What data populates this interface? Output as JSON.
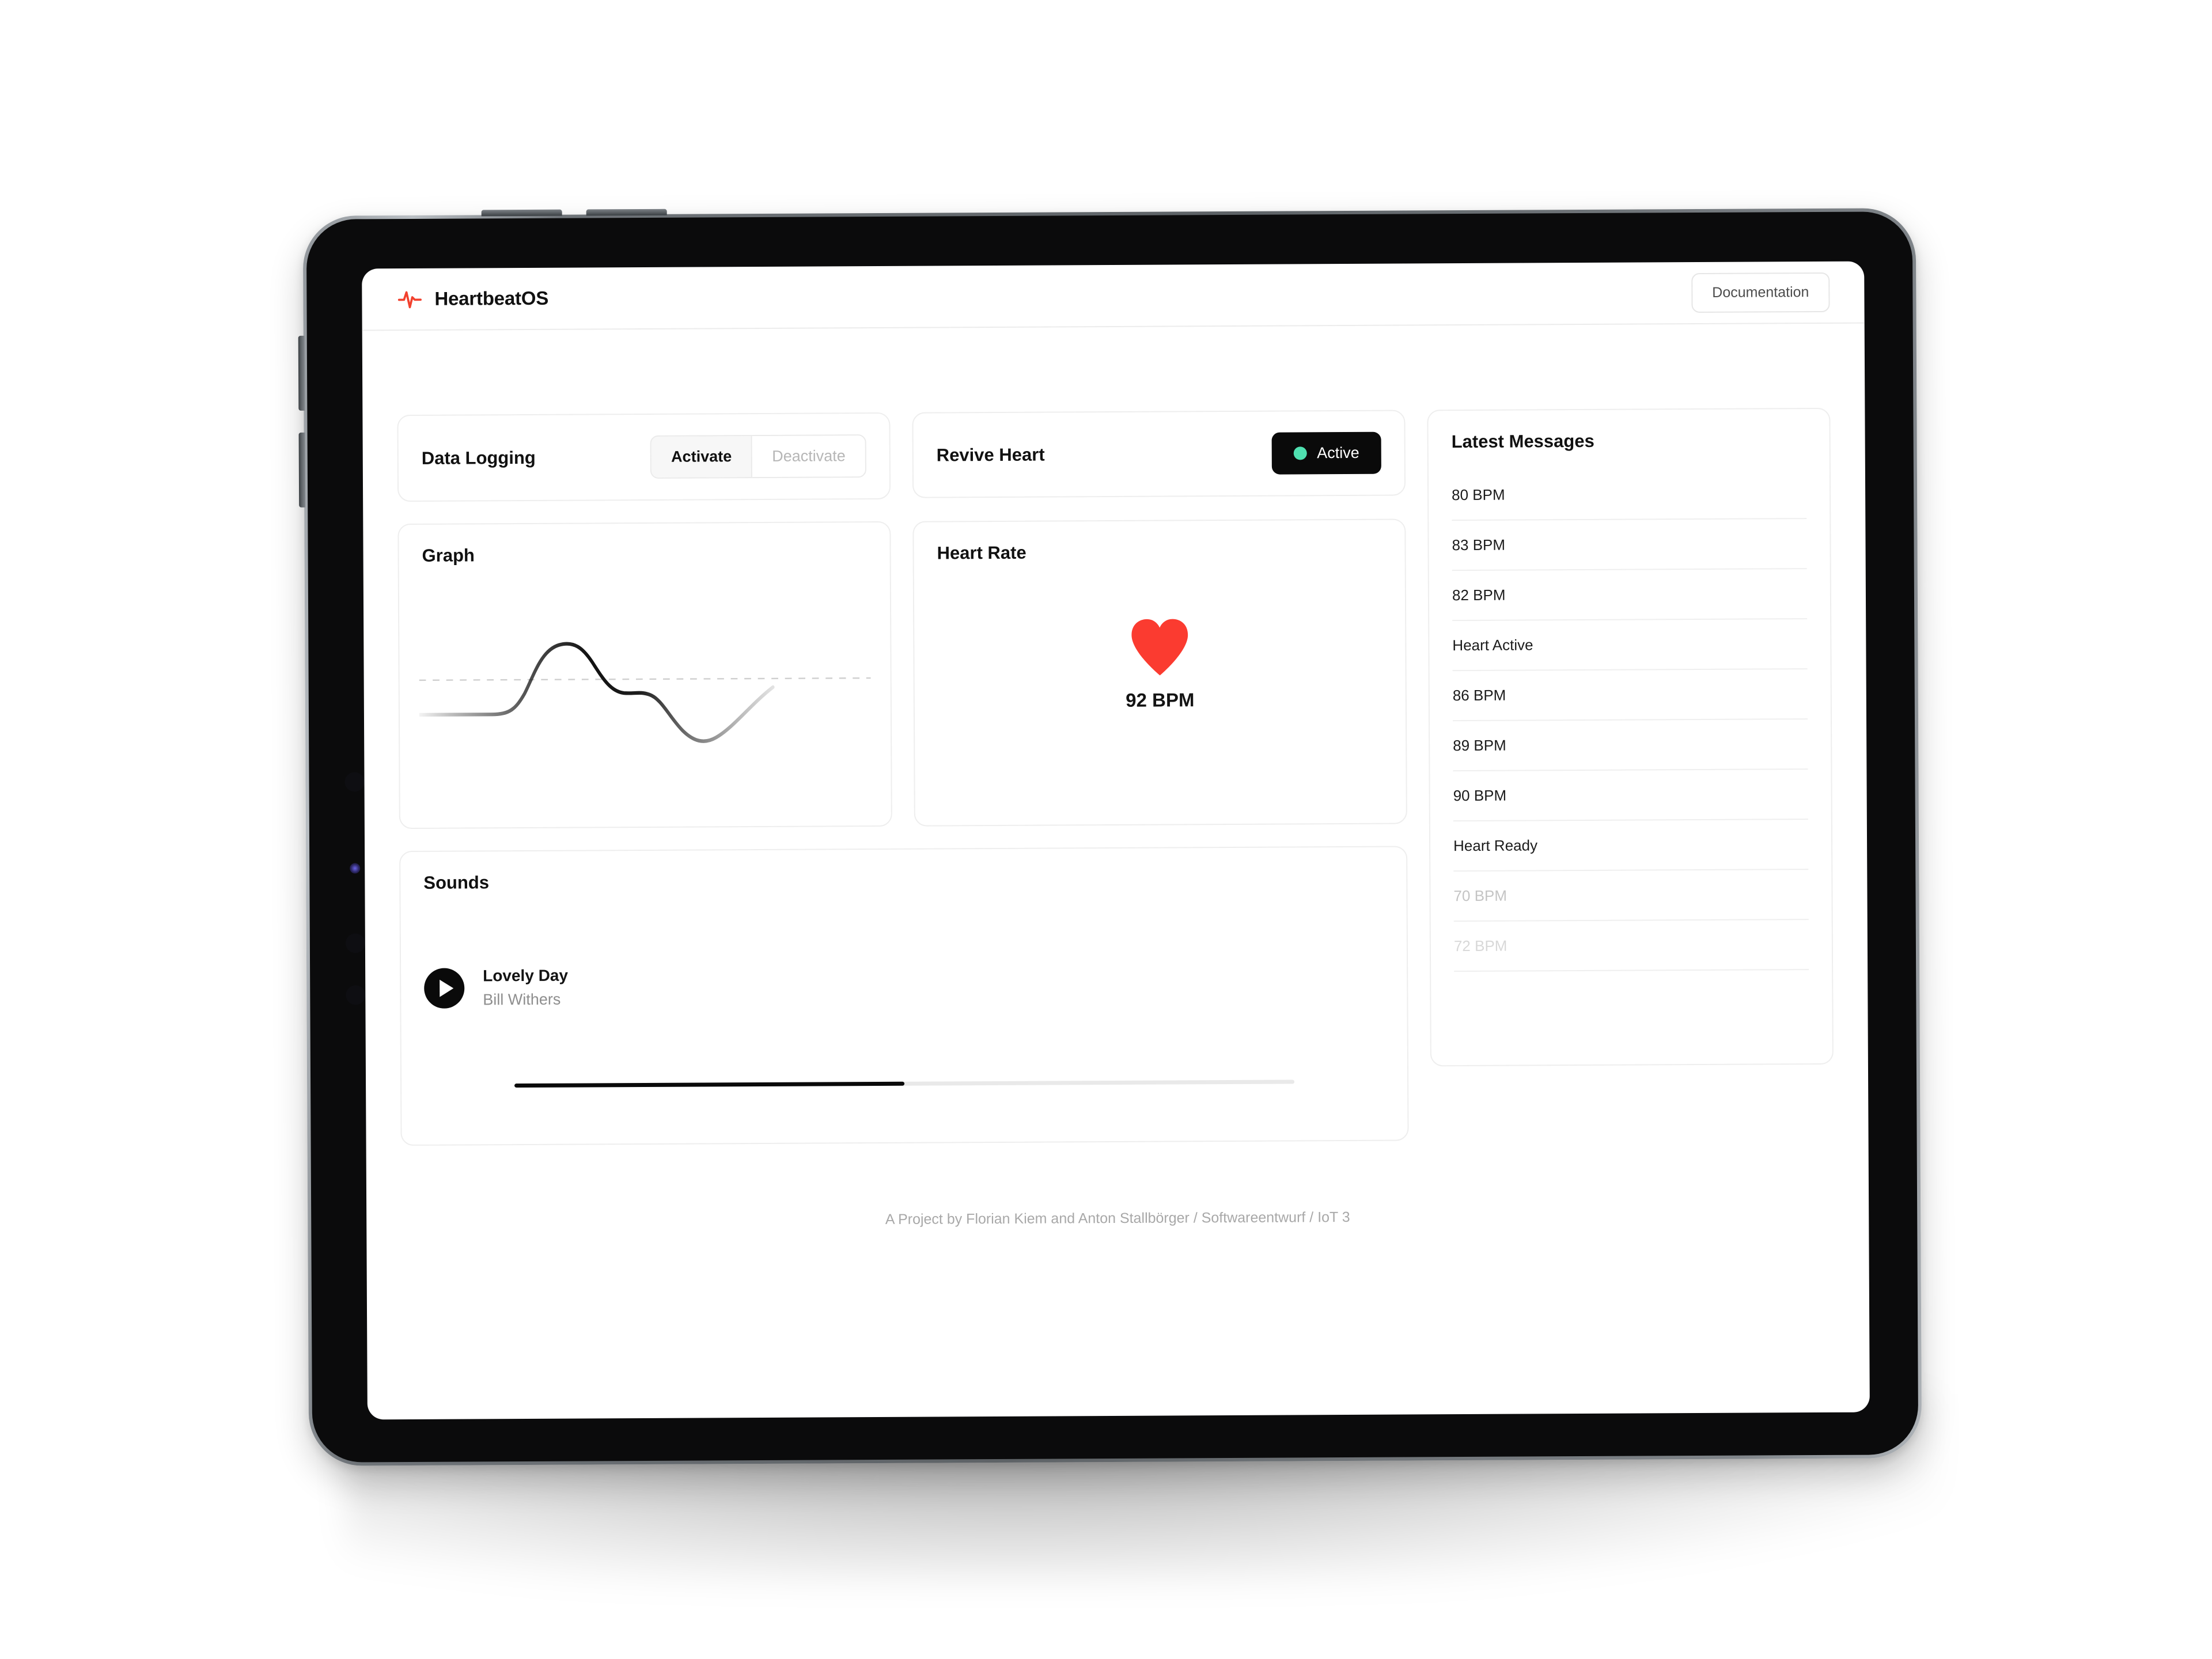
{
  "header": {
    "brand_title": "HeartbeatOS",
    "brand_icon": "pulse-activity-icon",
    "documentation_label": "Documentation"
  },
  "data_logging": {
    "title": "Data Logging",
    "activate_label": "Activate",
    "deactivate_label": "Deactivate",
    "selected": "Activate"
  },
  "revive_heart": {
    "title": "Revive Heart",
    "status_label": "Active",
    "status_dot_color": "#4FE0B0",
    "badge_bg": "#0A0A0A"
  },
  "graph": {
    "title": "Graph"
  },
  "heart_rate": {
    "title": "Heart Rate",
    "icon": "heart-icon",
    "heart_color": "#FB3B30",
    "value": "92 BPM"
  },
  "sounds": {
    "title": "Sounds",
    "play_icon": "play-icon",
    "track_title": "Lovely Day",
    "track_artist": "Bill Withers",
    "progress_percent": 50
  },
  "messages": {
    "title": "Latest Messages",
    "items": [
      {
        "text": "80 BPM",
        "style": "normal"
      },
      {
        "text": "83 BPM",
        "style": "normal"
      },
      {
        "text": "82 BPM",
        "style": "normal"
      },
      {
        "text": "Heart Active",
        "style": "normal"
      },
      {
        "text": "86 BPM",
        "style": "normal"
      },
      {
        "text": "89 BPM",
        "style": "normal"
      },
      {
        "text": "90 BPM",
        "style": "normal"
      },
      {
        "text": "Heart Ready",
        "style": "normal"
      },
      {
        "text": "70 BPM",
        "style": "faded-1"
      },
      {
        "text": "72 BPM",
        "style": "faded-2"
      }
    ]
  },
  "footer": {
    "credit": "A Project by Florian Kiem and Anton Stallbörger / Softwareentwurf / IoT 3"
  },
  "chart_data": {
    "type": "line",
    "title": "Graph",
    "xlabel": "",
    "ylabel": "",
    "grid": false,
    "legend": "none",
    "baseline": 0,
    "x": [
      0,
      10,
      20,
      28,
      34,
      40,
      46,
      52,
      58,
      64,
      70,
      76,
      82,
      88,
      94,
      100
    ],
    "values": [
      -18,
      -18,
      -18,
      -16,
      -2,
      20,
      34,
      36,
      28,
      14,
      2,
      0,
      -10,
      -30,
      -40,
      -22
    ],
    "ylim": [
      -50,
      45
    ],
    "series": [
      {
        "name": "heartbeat-waveform",
        "values": [
          -18,
          -18,
          -18,
          -16,
          -2,
          20,
          34,
          36,
          28,
          14,
          2,
          0,
          -10,
          -30,
          -40,
          -22
        ]
      }
    ],
    "annotations": [
      "dashed horizontal baseline at y=0"
    ]
  }
}
